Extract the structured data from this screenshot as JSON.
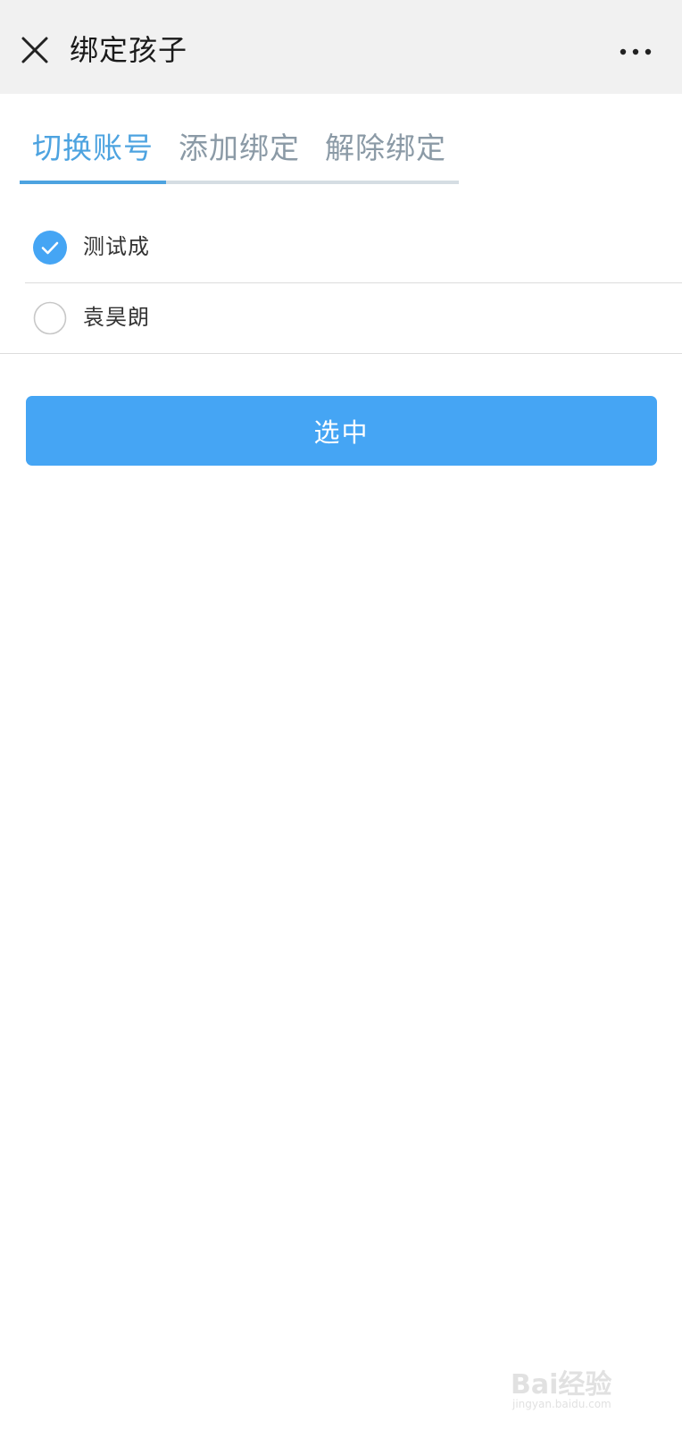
{
  "header": {
    "title": "绑定孩子",
    "close_icon": "close-icon",
    "more_icon": "more-icon"
  },
  "tabs": [
    {
      "label": "切换账号",
      "active": true
    },
    {
      "label": "添加绑定",
      "active": false
    },
    {
      "label": "解除绑定",
      "active": false
    }
  ],
  "list": {
    "items": [
      {
        "label": "测试成",
        "checked": true
      },
      {
        "label": "袁昊朗",
        "checked": false
      }
    ]
  },
  "actions": {
    "select_label": "选中"
  },
  "watermark": {
    "brand": "Bai经验",
    "url": "jingyan.baidu.com"
  },
  "colors": {
    "accent": "#45a5f4",
    "tab_active": "#4da3e0",
    "tab_inactive": "#8b9aa6",
    "header_bg": "#f1f1f1"
  }
}
